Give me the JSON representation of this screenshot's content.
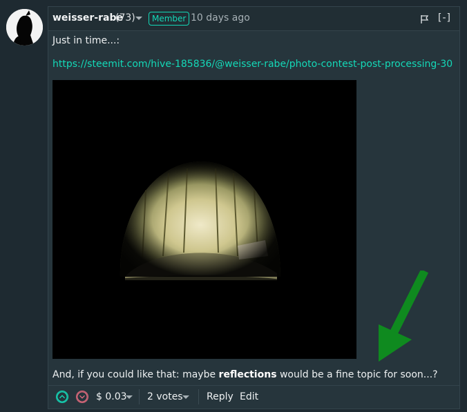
{
  "comment": {
    "author": "weisser-rabe",
    "reputation": "(73)",
    "badge": "Member",
    "time_ago": "10 days ago",
    "collapse_label": "[-]",
    "body": {
      "line1": "Just in time...:",
      "link": "https://steemit.com/hive-185836/@weisser-rabe/photo-contest-post-processing-30",
      "line2_pre": "And, if you could like that: maybe ",
      "line2_bold": "reflections",
      "line2_post": " would be a fine topic for soon...?"
    },
    "footer": {
      "payout": "$ 0.03",
      "votes": "2 votes",
      "reply": "Reply",
      "edit": "Edit"
    }
  },
  "colors": {
    "accent": "#14d9b8",
    "downvote": "#e06a7d",
    "annotation_arrow": "#0f8a1f"
  },
  "icons": {
    "flag": "flag-icon",
    "upvote": "chevron-up-circle-icon",
    "downvote": "chevron-down-circle-icon"
  }
}
